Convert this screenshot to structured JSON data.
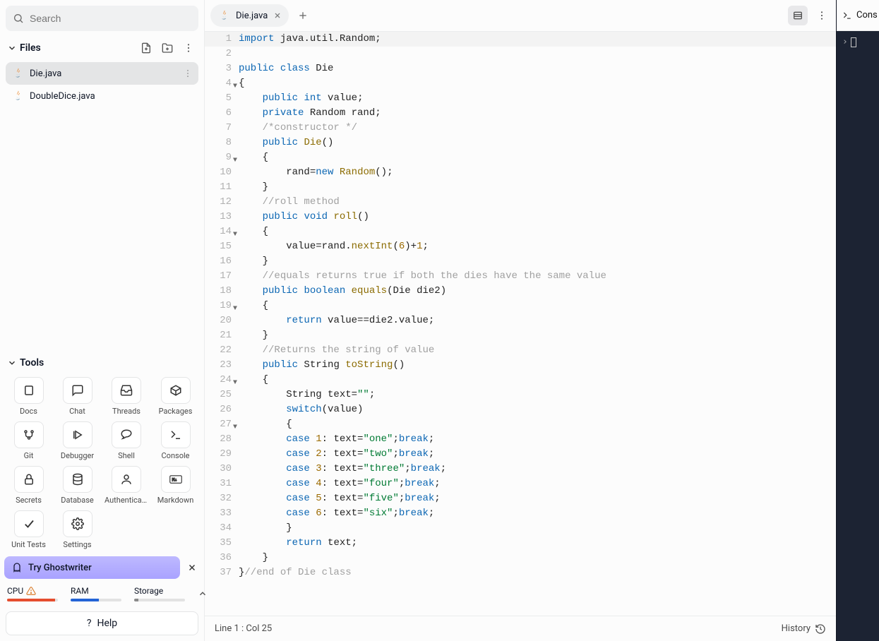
{
  "search": {
    "placeholder": "Search"
  },
  "files": {
    "title": "Files",
    "items": [
      {
        "name": "Die.java",
        "active": true
      },
      {
        "name": "DoubleDice.java",
        "active": false
      }
    ]
  },
  "tools": {
    "title": "Tools",
    "items": [
      {
        "name": "Docs",
        "icon": "book"
      },
      {
        "name": "Chat",
        "icon": "chat"
      },
      {
        "name": "Threads",
        "icon": "inbox"
      },
      {
        "name": "Packages",
        "icon": "cube"
      },
      {
        "name": "Git",
        "icon": "git"
      },
      {
        "name": "Debugger",
        "icon": "play"
      },
      {
        "name": "Shell",
        "icon": "shell"
      },
      {
        "name": "Console",
        "icon": "terminal"
      },
      {
        "name": "Secrets",
        "icon": "lock"
      },
      {
        "name": "Database",
        "icon": "database"
      },
      {
        "name": "Authenticat...",
        "icon": "user"
      },
      {
        "name": "Markdown",
        "icon": "md"
      },
      {
        "name": "Unit Tests",
        "icon": "check"
      },
      {
        "name": "Settings",
        "icon": "gear"
      }
    ]
  },
  "ghostwriter": {
    "label": "Try Ghostwriter"
  },
  "metrics": {
    "cpu": {
      "label": "CPU",
      "pct": 95,
      "color": "#E54D2E"
    },
    "ram": {
      "label": "RAM",
      "pct": 55,
      "color": "#2363D6"
    },
    "storage": {
      "label": "Storage",
      "pct": 8,
      "color": "#8A8A8A"
    }
  },
  "help": {
    "label": "Help"
  },
  "tabs": {
    "active": "Die.java"
  },
  "status": {
    "position": "Line 1 : Col 25",
    "history": "History"
  },
  "console": {
    "title": "Cons",
    "prompt": ""
  },
  "code": {
    "language": "java",
    "lines": [
      {
        "n": 1,
        "hl": true,
        "tokens": [
          [
            "kw",
            "import"
          ],
          [
            "id",
            " java"
          ],
          [
            "id",
            "."
          ],
          [
            "id",
            "util"
          ],
          [
            "id",
            "."
          ],
          [
            "id",
            "Random"
          ],
          [
            "id",
            ";"
          ]
        ]
      },
      {
        "n": 2,
        "tokens": []
      },
      {
        "n": 3,
        "tokens": [
          [
            "mod",
            "public"
          ],
          [
            "id",
            " "
          ],
          [
            "mod",
            "class"
          ],
          [
            "id",
            " Die"
          ]
        ]
      },
      {
        "n": 4,
        "fold": true,
        "tokens": [
          [
            "id",
            "{"
          ]
        ]
      },
      {
        "n": 5,
        "tokens": [
          [
            "id",
            "    "
          ],
          [
            "mod",
            "public"
          ],
          [
            "id",
            " "
          ],
          [
            "type",
            "int"
          ],
          [
            "id",
            " value;"
          ]
        ]
      },
      {
        "n": 6,
        "tokens": [
          [
            "id",
            "    "
          ],
          [
            "mod",
            "private"
          ],
          [
            "id",
            " Random rand;"
          ]
        ]
      },
      {
        "n": 7,
        "tokens": [
          [
            "id",
            "    "
          ],
          [
            "com",
            "/*constructor */"
          ]
        ]
      },
      {
        "n": 8,
        "tokens": [
          [
            "id",
            "    "
          ],
          [
            "mod",
            "public"
          ],
          [
            "id",
            " "
          ],
          [
            "fn",
            "Die"
          ],
          [
            "id",
            "()"
          ]
        ]
      },
      {
        "n": 9,
        "fold": true,
        "tokens": [
          [
            "id",
            "    {"
          ]
        ]
      },
      {
        "n": 10,
        "tokens": [
          [
            "id",
            "        rand"
          ],
          [
            "id",
            "="
          ],
          [
            "kw",
            "new"
          ],
          [
            "id",
            " "
          ],
          [
            "fn",
            "Random"
          ],
          [
            "id",
            "();"
          ]
        ]
      },
      {
        "n": 11,
        "tokens": [
          [
            "id",
            "    }"
          ]
        ]
      },
      {
        "n": 12,
        "tokens": [
          [
            "id",
            "    "
          ],
          [
            "com",
            "//roll method"
          ]
        ]
      },
      {
        "n": 13,
        "tokens": [
          [
            "id",
            "    "
          ],
          [
            "mod",
            "public"
          ],
          [
            "id",
            " "
          ],
          [
            "type",
            "void"
          ],
          [
            "id",
            " "
          ],
          [
            "fn",
            "roll"
          ],
          [
            "id",
            "()"
          ]
        ]
      },
      {
        "n": 14,
        "fold": true,
        "tokens": [
          [
            "id",
            "    {"
          ]
        ]
      },
      {
        "n": 15,
        "tokens": [
          [
            "id",
            "        value=rand."
          ],
          [
            "fn",
            "nextInt"
          ],
          [
            "id",
            "("
          ],
          [
            "num",
            "6"
          ],
          [
            "id",
            ")+"
          ],
          [
            "num",
            "1"
          ],
          [
            "id",
            ";"
          ]
        ]
      },
      {
        "n": 16,
        "tokens": [
          [
            "id",
            "    }"
          ]
        ]
      },
      {
        "n": 17,
        "tokens": [
          [
            "id",
            "    "
          ],
          [
            "com",
            "//equals returns true if both the dies have the same value"
          ]
        ]
      },
      {
        "n": 18,
        "tokens": [
          [
            "id",
            "    "
          ],
          [
            "mod",
            "public"
          ],
          [
            "id",
            " "
          ],
          [
            "type",
            "boolean"
          ],
          [
            "id",
            " "
          ],
          [
            "fn",
            "equals"
          ],
          [
            "id",
            "("
          ],
          [
            "id",
            "Die die2"
          ],
          [
            "id",
            ")"
          ]
        ]
      },
      {
        "n": 19,
        "fold": true,
        "tokens": [
          [
            "id",
            "    {"
          ]
        ]
      },
      {
        "n": 20,
        "tokens": [
          [
            "id",
            "        "
          ],
          [
            "kw",
            "return"
          ],
          [
            "id",
            " value==die2.value;"
          ]
        ]
      },
      {
        "n": 21,
        "tokens": [
          [
            "id",
            "    }"
          ]
        ]
      },
      {
        "n": 22,
        "tokens": [
          [
            "id",
            "    "
          ],
          [
            "com",
            "//Returns the string of value"
          ]
        ]
      },
      {
        "n": 23,
        "tokens": [
          [
            "id",
            "    "
          ],
          [
            "mod",
            "public"
          ],
          [
            "id",
            " String "
          ],
          [
            "fn",
            "toString"
          ],
          [
            "id",
            "()"
          ]
        ]
      },
      {
        "n": 24,
        "fold": true,
        "tokens": [
          [
            "id",
            "    {"
          ]
        ]
      },
      {
        "n": 25,
        "tokens": [
          [
            "id",
            "        String text="
          ],
          [
            "str",
            "\"\""
          ],
          [
            "id",
            ";"
          ]
        ]
      },
      {
        "n": 26,
        "tokens": [
          [
            "id",
            "        "
          ],
          [
            "kw",
            "switch"
          ],
          [
            "id",
            "(value)"
          ]
        ]
      },
      {
        "n": 27,
        "fold": true,
        "tokens": [
          [
            "id",
            "        {"
          ]
        ]
      },
      {
        "n": 28,
        "tokens": [
          [
            "id",
            "        "
          ],
          [
            "kw",
            "case"
          ],
          [
            "id",
            " "
          ],
          [
            "num",
            "1"
          ],
          [
            "id",
            ": text="
          ],
          [
            "str",
            "\"one\""
          ],
          [
            "id",
            ";"
          ],
          [
            "kw",
            "break"
          ],
          [
            "id",
            ";"
          ]
        ]
      },
      {
        "n": 29,
        "tokens": [
          [
            "id",
            "        "
          ],
          [
            "kw",
            "case"
          ],
          [
            "id",
            " "
          ],
          [
            "num",
            "2"
          ],
          [
            "id",
            ": text="
          ],
          [
            "str",
            "\"two\""
          ],
          [
            "id",
            ";"
          ],
          [
            "kw",
            "break"
          ],
          [
            "id",
            ";"
          ]
        ]
      },
      {
        "n": 30,
        "tokens": [
          [
            "id",
            "        "
          ],
          [
            "kw",
            "case"
          ],
          [
            "id",
            " "
          ],
          [
            "num",
            "3"
          ],
          [
            "id",
            ": text="
          ],
          [
            "str",
            "\"three\""
          ],
          [
            "id",
            ";"
          ],
          [
            "kw",
            "break"
          ],
          [
            "id",
            ";"
          ]
        ]
      },
      {
        "n": 31,
        "tokens": [
          [
            "id",
            "        "
          ],
          [
            "kw",
            "case"
          ],
          [
            "id",
            " "
          ],
          [
            "num",
            "4"
          ],
          [
            "id",
            ": text="
          ],
          [
            "str",
            "\"four\""
          ],
          [
            "id",
            ";"
          ],
          [
            "kw",
            "break"
          ],
          [
            "id",
            ";"
          ]
        ]
      },
      {
        "n": 32,
        "tokens": [
          [
            "id",
            "        "
          ],
          [
            "kw",
            "case"
          ],
          [
            "id",
            " "
          ],
          [
            "num",
            "5"
          ],
          [
            "id",
            ": text="
          ],
          [
            "str",
            "\"five\""
          ],
          [
            "id",
            ";"
          ],
          [
            "kw",
            "break"
          ],
          [
            "id",
            ";"
          ]
        ]
      },
      {
        "n": 33,
        "tokens": [
          [
            "id",
            "        "
          ],
          [
            "kw",
            "case"
          ],
          [
            "id",
            " "
          ],
          [
            "num",
            "6"
          ],
          [
            "id",
            ": text="
          ],
          [
            "str",
            "\"six\""
          ],
          [
            "id",
            ";"
          ],
          [
            "kw",
            "break"
          ],
          [
            "id",
            ";"
          ]
        ]
      },
      {
        "n": 34,
        "tokens": [
          [
            "id",
            "        }"
          ]
        ]
      },
      {
        "n": 35,
        "tokens": [
          [
            "id",
            "        "
          ],
          [
            "kw",
            "return"
          ],
          [
            "id",
            " text;"
          ]
        ]
      },
      {
        "n": 36,
        "tokens": [
          [
            "id",
            "    }"
          ]
        ]
      },
      {
        "n": 37,
        "tokens": [
          [
            "id",
            "}"
          ],
          [
            "com",
            "//end of Die class"
          ]
        ]
      }
    ]
  }
}
